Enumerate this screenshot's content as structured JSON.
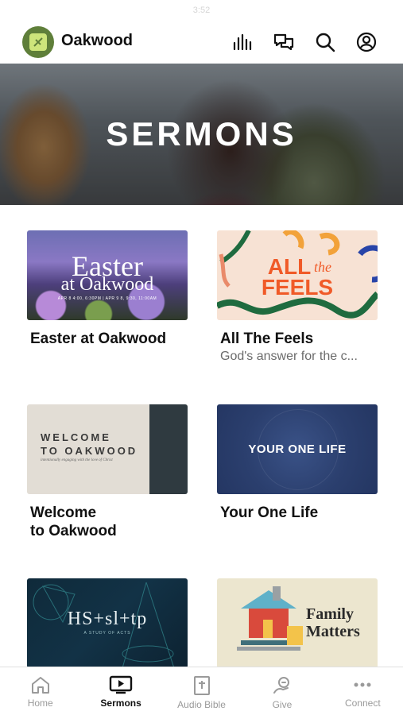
{
  "status": {
    "time": "3:52"
  },
  "header": {
    "brand": "Oakwood"
  },
  "hero": {
    "title": "SERMONS"
  },
  "cards": [
    {
      "title": "Easter at Oakwood",
      "subtitle": "",
      "thumb_line1": "Easter",
      "thumb_line2": "at Oakwood",
      "thumb_small": "APR 8 4:00, 6:30PM | APR 9 8, 9:30, 11:00AM"
    },
    {
      "title": "All The Feels",
      "subtitle": "God's answer for the c...",
      "thumb_line1": "ALL",
      "thumb_the": "the",
      "thumb_line2": "FEELS"
    },
    {
      "title": "Welcome\nto Oakwood",
      "subtitle": "",
      "thumb_line1": "WELCOME",
      "thumb_line2": "TO OAKWOOD",
      "thumb_small": "intentionally engaging with the love of Christ"
    },
    {
      "title": "Your One Life",
      "subtitle": "",
      "thumb_line1": "YOUR ONE LIFE"
    },
    {
      "title": "",
      "subtitle": "",
      "thumb_line1": "HS+sl+tp",
      "thumb_small": "A STUDY OF ACTS"
    },
    {
      "title": "",
      "subtitle": "",
      "thumb_line1": "Family",
      "thumb_line2": "Matters"
    }
  ],
  "tabs": [
    {
      "label": "Home",
      "icon": "home-icon"
    },
    {
      "label": "Sermons",
      "icon": "tv-play-icon"
    },
    {
      "label": "Audio Bible",
      "icon": "bible-icon"
    },
    {
      "label": "Give",
      "icon": "give-icon"
    },
    {
      "label": "Connect",
      "icon": "more-icon"
    }
  ],
  "colors": {
    "accent": "#5f7f3a",
    "tab_active": "#111111",
    "tab_inactive": "#9a9a9a"
  }
}
